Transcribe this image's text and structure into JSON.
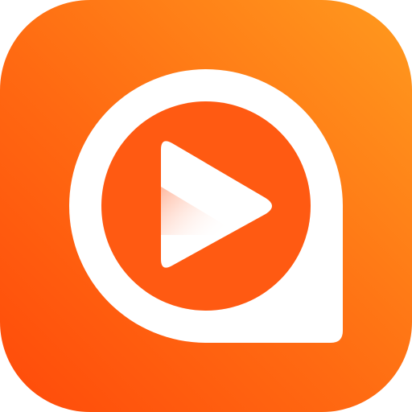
{
  "app_icon": {
    "icon": "play-chat-bubble-icon",
    "colors": {
      "gradient_start": "#FF9A1E",
      "gradient_mid": "#FF6A12",
      "gradient_end": "#FF4A0A",
      "bubble": "#FFFFFF",
      "inner_circle": "#FF5A12",
      "play": "#FFFFFF",
      "play_shadow": "#FFB49A"
    }
  }
}
